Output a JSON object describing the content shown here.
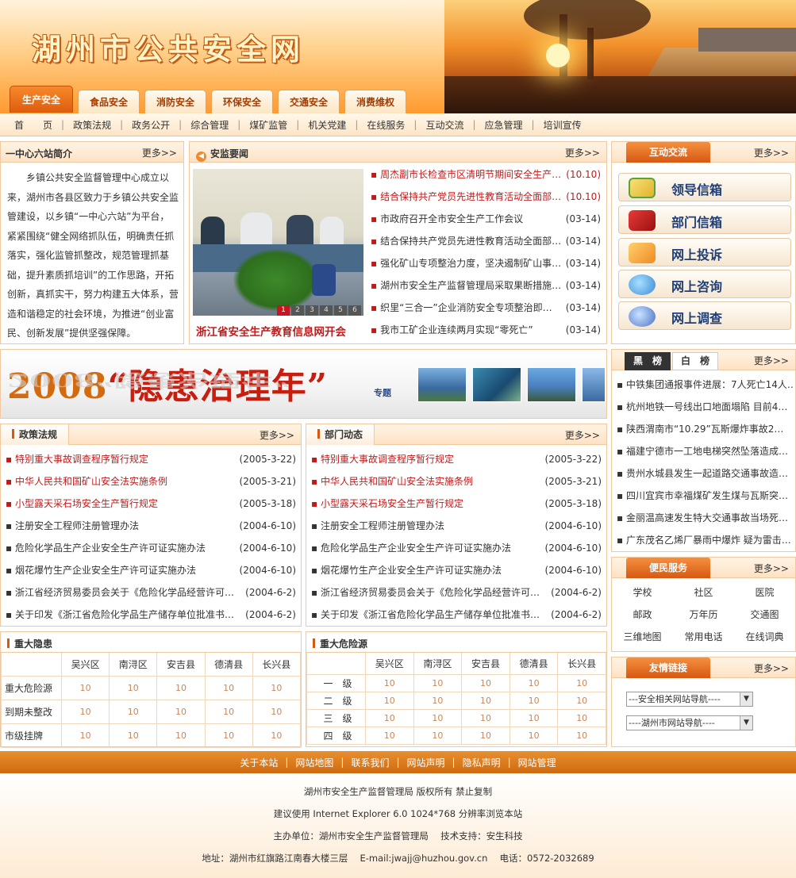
{
  "header": {
    "title": "湖州市公共安全网"
  },
  "tabs": [
    {
      "label": "生产安全",
      "active": true
    },
    {
      "label": "食品安全"
    },
    {
      "label": "消防安全"
    },
    {
      "label": "环保安全"
    },
    {
      "label": "交通安全"
    },
    {
      "label": "消费维权"
    }
  ],
  "nav": [
    "首　　页",
    "政策法规",
    "政务公开",
    "综合管理",
    "煤矿监管",
    "机关党建",
    "在线服务",
    "互动交流",
    "应急管理",
    "培训宣传"
  ],
  "more_label": "更多>>",
  "intro": {
    "title": "一中心六站简介",
    "text": "乡镇公共安全监督管理中心成立以来，湖州市各县区致力于乡镇公共安全监管建设，以乡镇“一中心六站”为平台，紧紧围绕“健全网络抓队伍，明确责任抓落实，强化监管抓整改，规范管理抓基础，提升素质抓培训”的工作思路，开拓创新，真抓实干，努力构建五大体系，营造和谐稳定的社会环境，为推进“创业富民、创新发展”提供坚强保障。"
  },
  "news": {
    "title": "安监要闻",
    "photo_caption": "浙江省安全生产教育信息网开会",
    "pager": [
      "1",
      "2",
      "3",
      "4",
      "5",
      "6"
    ],
    "items": [
      {
        "text": "周杰副市长检查市区清明节期间安全生产…",
        "date": "(10.10)",
        "hot": true
      },
      {
        "text": "结合保持共产党员先进性教育活动全面部…",
        "date": "(10.10)",
        "hot": true
      },
      {
        "text": "市政府召开全市安全生产工作会议",
        "date": "(03-14)"
      },
      {
        "text": "结合保持共产党员先进性教育活动全面部…",
        "date": "(03-14)"
      },
      {
        "text": "强化矿山专项整治力度，坚决遏制矿山事…",
        "date": "(03-14)"
      },
      {
        "text": "湖州市安全生产监督管理局采取果断措施…",
        "date": "(03-14)"
      },
      {
        "text": "织里“三合一”企业消防安全专项整治即…",
        "date": "(03-14)"
      },
      {
        "text": "我市工矿企业连续两月实现“零死亡”",
        "date": "(03-14)"
      }
    ]
  },
  "interact": {
    "title": "互动交流",
    "buttons": [
      {
        "label": "领导信箱",
        "icon": "mail-envelope-icon"
      },
      {
        "label": "部门信箱",
        "icon": "mailbox-icon"
      },
      {
        "label": "网上投诉",
        "icon": "complaint-folder-icon"
      },
      {
        "label": "网上咨询",
        "icon": "chat-bubbles-icon"
      },
      {
        "label": "网上调查",
        "icon": "survey-globe-icon"
      }
    ]
  },
  "banner": {
    "year": "2008",
    "title": "“隐患治理年”",
    "tag": "专题"
  },
  "blacklist": {
    "tab_black": "黑　榜",
    "tab_white": "白　榜",
    "items": [
      "中铁集团通报事件进展：7人死亡14人…",
      "杭州地铁一号线出口地面塌陷 目前4…",
      "陕西渭南市“10.29”瓦斯爆炸事故2…",
      "福建宁德市一工地电梯突然坠落造成…",
      "贵州水城县发生一起道路交通事故造…",
      "四川宜宾市幸福煤矿发生煤与瓦斯突…",
      "金丽温高速发生特大交通事故当场死…",
      "广东茂名乙烯厂暴雨中爆炸 疑为雷击…"
    ]
  },
  "policy": {
    "title": "政策法规",
    "items": [
      {
        "text": "特别重大事故调查程序暂行规定",
        "date": "(2005-3-22)",
        "hot": true
      },
      {
        "text": "中华人民共和国矿山安全法实施条例",
        "date": "(2005-3-21)",
        "hot": true
      },
      {
        "text": "小型露天采石场安全生产暂行规定",
        "date": "(2005-3-18)",
        "hot": true
      },
      {
        "text": "注册安全工程师注册管理办法",
        "date": "(2004-6-10)"
      },
      {
        "text": "危险化学品生产企业安全生产许可证实施办法",
        "date": "(2004-6-10)"
      },
      {
        "text": "烟花爆竹生产企业安全生产许可证实施办法",
        "date": "(2004-6-10)"
      },
      {
        "text": "浙江省经济贸易委员会关于《危险化学品经营许可…",
        "date": "(2004-6-2)"
      },
      {
        "text": "关于印发《浙江省危险化学品生产储存单位批准书…",
        "date": "(2004-6-2)"
      }
    ]
  },
  "dept": {
    "title": "部门动态",
    "items": [
      {
        "text": "特别重大事故调查程序暂行规定",
        "date": "(2005-3-22)",
        "hot": true
      },
      {
        "text": "中华人民共和国矿山安全法实施条例",
        "date": "(2005-3-21)",
        "hot": true
      },
      {
        "text": "小型露天采石场安全生产暂行规定",
        "date": "(2005-3-18)",
        "hot": true
      },
      {
        "text": "注册安全工程师注册管理办法",
        "date": "(2004-6-10)"
      },
      {
        "text": "危险化学品生产企业安全生产许可证实施办法",
        "date": "(2004-6-10)"
      },
      {
        "text": "烟花爆竹生产企业安全生产许可证实施办法",
        "date": "(2004-6-10)"
      },
      {
        "text": "浙江省经济贸易委员会关于《危险化学品经营许可…",
        "date": "(2004-6-2)"
      },
      {
        "text": "关于印发《浙江省危险化学品生产储存单位批准书…",
        "date": "(2004-6-2)"
      }
    ]
  },
  "services": {
    "title": "便民服务",
    "items": [
      "学校",
      "社区",
      "医院",
      "邮政",
      "万年历",
      "交通图",
      "三维地图",
      "常用电话",
      "在线词典"
    ]
  },
  "hazards": {
    "title": "重大隐患",
    "columns": [
      "吴兴区",
      "南浔区",
      "安吉县",
      "德清县",
      "长兴县"
    ],
    "rows": [
      {
        "label": "重大危险源",
        "values": [
          "10",
          "10",
          "10",
          "10",
          "10"
        ]
      },
      {
        "label": "到期未整改",
        "values": [
          "10",
          "10",
          "10",
          "10",
          "10"
        ]
      },
      {
        "label": "市级挂牌",
        "values": [
          "10",
          "10",
          "10",
          "10",
          "10"
        ]
      }
    ]
  },
  "danger": {
    "title": "重大危险源",
    "columns": [
      "吴兴区",
      "南浔区",
      "安吉县",
      "德清县",
      "长兴县"
    ],
    "rows": [
      {
        "label": "一　级",
        "values": [
          "10",
          "10",
          "10",
          "10",
          "10"
        ]
      },
      {
        "label": "二　级",
        "values": [
          "10",
          "10",
          "10",
          "10",
          "10"
        ]
      },
      {
        "label": "三　级",
        "values": [
          "10",
          "10",
          "10",
          "10",
          "10"
        ]
      },
      {
        "label": "四　级",
        "values": [
          "10",
          "10",
          "10",
          "10",
          "10"
        ]
      }
    ]
  },
  "links": {
    "title": "友情链接",
    "selects": [
      "---安全相关网站导航----",
      "----湖州市网站导航----"
    ]
  },
  "footer": {
    "links": [
      "关于本站",
      "网站地图",
      "联系我们",
      "网站声明",
      "隐私声明",
      "网站管理"
    ],
    "lines": [
      "湖州市安全生产监督管理局 版权所有 禁止复制",
      "建议使用 Internet Explorer 6.0 1024*768 分辨率浏览本站",
      "主办单位：湖州市安全生产监督管理局　 技术支持：安生科技",
      "地址：湖州市红旗路江南春大楼三层　 E-mail:jwajj@huzhou.gov.cn　 电话：0572-2032689"
    ]
  }
}
